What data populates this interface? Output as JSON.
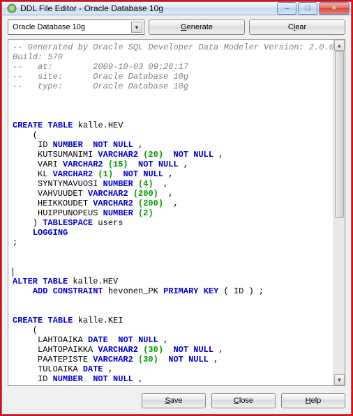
{
  "window": {
    "title": "DDL File Editor - Oracle Database 10g",
    "min_label": "–",
    "max_label": "□",
    "close_label": "×"
  },
  "toolbar": {
    "combo_value": "Oracle Database 10g",
    "combo_arrow": "▼",
    "generate_pre": "",
    "generate_u": "G",
    "generate_post": "enerate",
    "clear_pre": "C",
    "clear_u": "l",
    "clear_post": "ear"
  },
  "scrollbar": {
    "up": "▲",
    "down": "▼"
  },
  "bottom": {
    "save_u": "S",
    "save_post": "ave",
    "close_u": "C",
    "close_post": "lose",
    "help_u": "H",
    "help_post": "elp"
  },
  "code": {
    "c1": "-- Generated by Oracle SQL Developer Data Modeler Version: 2.0.0",
    "c1b": "Build: 570",
    "c2": "--   at:        2009-10-03 09:26:17",
    "c3": "--   site:      Oracle Database 10g",
    "c4": "--   type:      Oracle Database 10g",
    "kw_create": "CREATE",
    "kw_table": "TABLE",
    "kw_alter": "ALTER",
    "kw_add": "ADD",
    "kw_constraint": "CONSTRAINT",
    "kw_primary": "PRIMARY",
    "kw_key": "KEY",
    "kw_not": "NOT",
    "kw_null": "NULL",
    "kw_number": "NUMBER",
    "kw_varchar2": "VARCHAR2",
    "kw_date": "DATE",
    "kw_tablespace": "TABLESPACE",
    "kw_logging": "LOGGING",
    "t1_name": " kalle.HEV ",
    "t1_open": "    (",
    "t1_c1a": "     ID ",
    "t1_c2a": "     KUTSUMANIMI ",
    "t1_c3a": "     VARI ",
    "t1_c4a": "     KL ",
    "t1_c5a": "     SYNTYMAVUOSI ",
    "t1_c6a": "     VAHVUUDET ",
    "t1_c7a": "     HEIKKOUDET ",
    "t1_c8a": "     HUIPPUNOPEUS ",
    "n20": " (20) ",
    "n15": " (15) ",
    "n1": " (1) ",
    "n4": " (4) ",
    "n200": " (200) ",
    "n2": " (2) ",
    "n30": " (30) ",
    "sp_comma": " , ",
    "sp_close": "    ) ",
    "users": " users ",
    "indent": "    ",
    "semi": ";",
    "alt_name": " kalle.HEV ",
    "alt_pk": " hevonen_PK ",
    "alt_col": " ( ID ) ;",
    "t2_name": " kalle.KEI ",
    "t2_c1a": "     LAHTOAIKA ",
    "t2_c2a": "     LAHTOPAIKKA ",
    "t2_c3a": "     PAATEPISTE ",
    "t2_c4a": "     TULOAIKA ",
    "t2_c5a": "     ID "
  }
}
